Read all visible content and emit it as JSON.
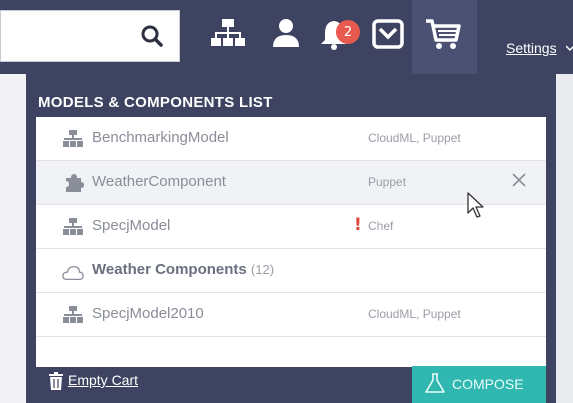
{
  "header": {
    "notification_count": "2",
    "settings_label": "Settings",
    "icons": [
      "search-icon",
      "sitemap-icon",
      "user-icon",
      "bell-icon",
      "inbox-icon",
      "cart-icon",
      "chevron-down-icon"
    ]
  },
  "panel": {
    "title": "MODELS & COMPONENTS LIST",
    "items": [
      {
        "icon": "model-icon",
        "name": "BenchmarkingModel",
        "tags": "CloudML, Puppet"
      },
      {
        "icon": "component-icon",
        "name": "WeatherComponent",
        "tags": "Puppet"
      },
      {
        "icon": "model-icon",
        "name": "SpecjModel",
        "tags": "Chef",
        "warning": "!"
      },
      {
        "icon": "cloud-icon",
        "name": "Weather Components",
        "count": "(12)"
      },
      {
        "icon": "model-icon",
        "name": "SpecjModel2010",
        "tags": "CloudML, Puppet"
      }
    ],
    "empty_cart_label": "Empty Cart",
    "compose_label": "COMPOSE"
  },
  "colors": {
    "topbar": "#3d4360",
    "accent": "#30b7b0",
    "badge": "#e85a4f",
    "warning": "#e0443b"
  }
}
